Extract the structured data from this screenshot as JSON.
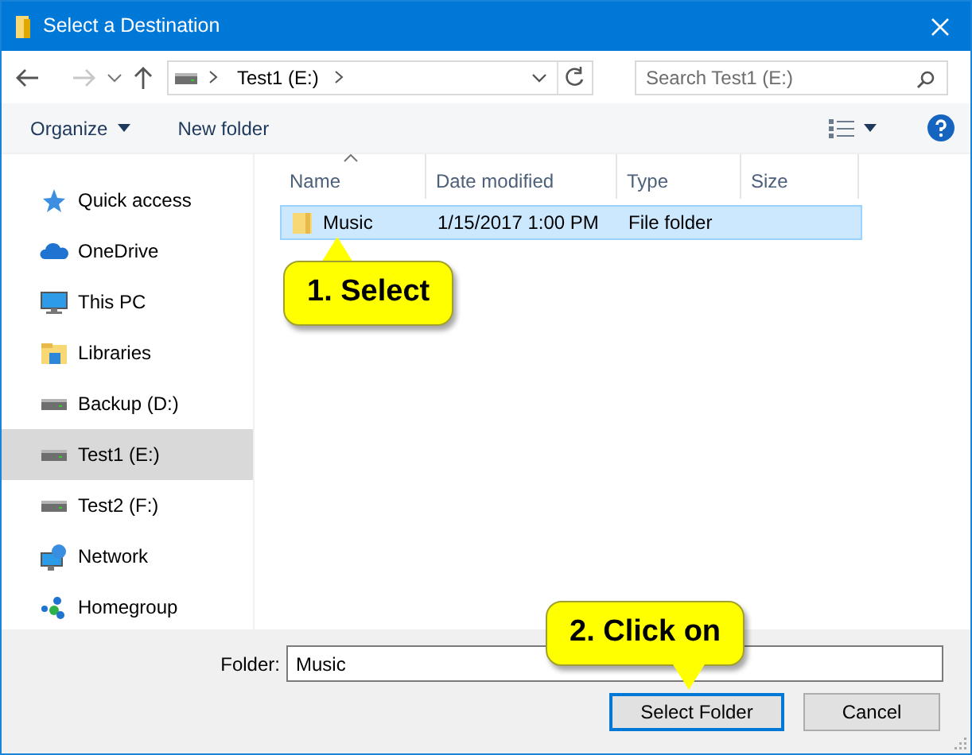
{
  "window": {
    "title": "Select a Destination"
  },
  "address": {
    "path": "Test1 (E:)"
  },
  "search": {
    "placeholder": "Search Test1 (E:)"
  },
  "toolbar": {
    "organize": "Organize",
    "new_folder": "New folder"
  },
  "sidebar": {
    "items": [
      {
        "label": "Quick access",
        "kind": "quick",
        "selected": false
      },
      {
        "label": "OneDrive",
        "kind": "cloud",
        "selected": false
      },
      {
        "label": "This PC",
        "kind": "pc",
        "selected": false
      },
      {
        "label": "Libraries",
        "kind": "libraries",
        "selected": false
      },
      {
        "label": "Backup (D:)",
        "kind": "drive",
        "selected": false
      },
      {
        "label": "Test1 (E:)",
        "kind": "drive",
        "selected": true
      },
      {
        "label": "Test2 (F:)",
        "kind": "drive",
        "selected": false
      },
      {
        "label": "Network",
        "kind": "network",
        "selected": false
      },
      {
        "label": "Homegroup",
        "kind": "homegroup",
        "selected": false
      }
    ]
  },
  "columns": [
    {
      "label": "Name",
      "sorted": true
    },
    {
      "label": "Date modified",
      "sorted": false
    },
    {
      "label": "Type",
      "sorted": false
    },
    {
      "label": "Size",
      "sorted": false
    }
  ],
  "rows": [
    {
      "name": "Music",
      "date": "1/15/2017 1:00 PM",
      "type": "File folder",
      "selected": true
    }
  ],
  "folder_field": {
    "label": "Folder:",
    "value": "Music"
  },
  "buttons": [
    {
      "label": "Select Folder",
      "default": true
    },
    {
      "label": "Cancel",
      "default": false
    }
  ],
  "callouts": [
    {
      "text": "1. Select"
    },
    {
      "text": "2. Click on"
    }
  ]
}
